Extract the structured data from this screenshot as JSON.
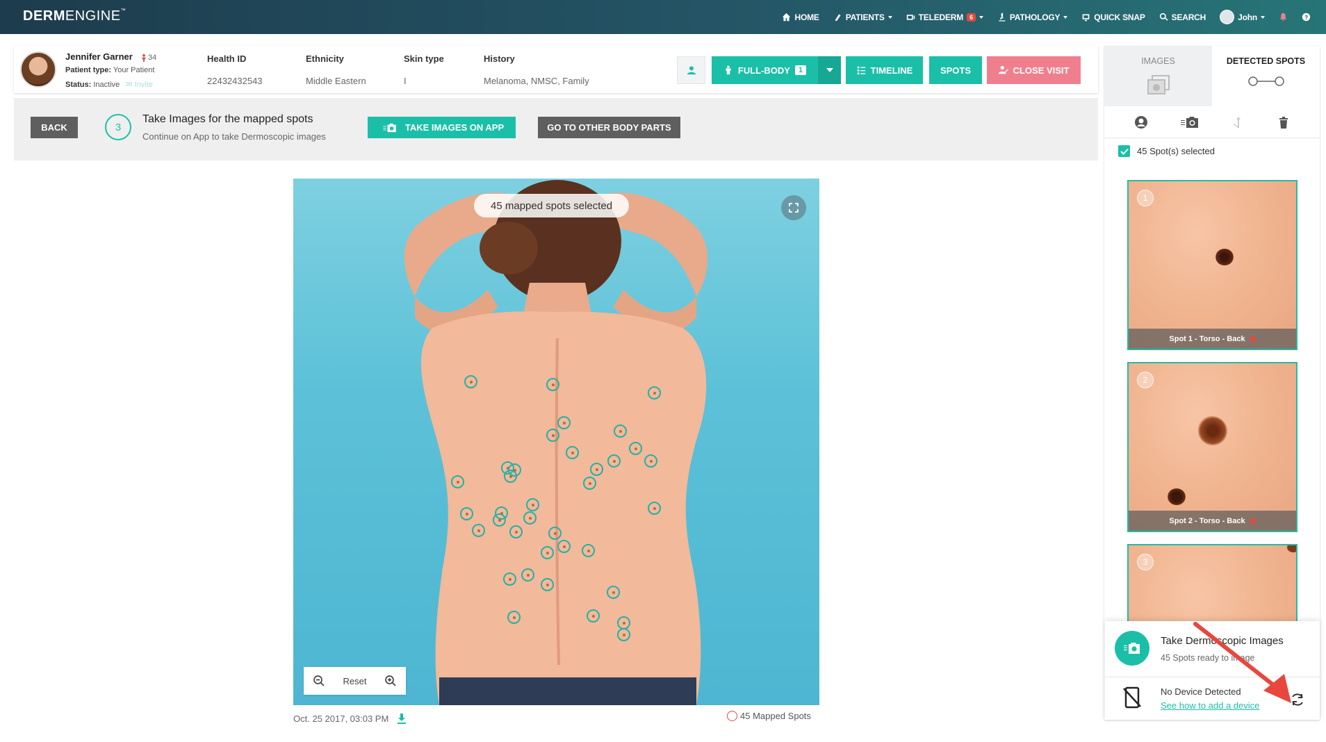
{
  "brand": {
    "bold": "DERM",
    "light": "ENGINE",
    "tm": "™"
  },
  "nav": {
    "items": [
      {
        "label": "HOME",
        "icon": "home-icon"
      },
      {
        "label": "PATIENTS",
        "icon": "user-icon",
        "caret": true
      },
      {
        "label": "TELEDERM",
        "icon": "telederm-icon",
        "badge": "6",
        "caret": true
      },
      {
        "label": "PATHOLOGY",
        "icon": "microscope-icon",
        "caret": true
      },
      {
        "label": "QUICK SNAP",
        "icon": "snap-icon"
      },
      {
        "label": "SEARCH",
        "icon": "search-icon"
      }
    ],
    "user": "John",
    "bell_icon": "bell-icon",
    "help_icon": "help-icon"
  },
  "patient": {
    "name": "Jennifer Garner",
    "age": "34",
    "type_label": "Patient type:",
    "type_value": "Your Patient",
    "status_label": "Status:",
    "status_value": "Inactive",
    "invite": "Invite",
    "fields": [
      {
        "label": "Health ID",
        "value": "22432432543"
      },
      {
        "label": "Ethnicity",
        "value": "Middle Eastern"
      },
      {
        "label": "Skin type",
        "value": "I"
      },
      {
        "label": "History",
        "value": "Melanoma, NMSC, Family"
      }
    ]
  },
  "header_buttons": {
    "full_body": "FULL-BODY",
    "full_body_count": "1",
    "timeline": "TIMELINE",
    "spots": "SPOTS",
    "close_visit": "CLOSE VISIT"
  },
  "action_strip": {
    "back": "BACK",
    "step_number": "3",
    "step_title": "Take Images for the mapped spots",
    "step_subtitle": "Continue on App to take Dermoscopic images",
    "take_images": "TAKE IMAGES ON APP",
    "other_parts": "GO TO OTHER BODY PARTS"
  },
  "viewer": {
    "pill": "45 mapped spots selected",
    "reset": "Reset",
    "date": "Oct. 25 2017, 03:03 PM",
    "mapped_count": "45 Mapped Spots",
    "spots": [
      [
        33.8,
        38.6
      ],
      [
        49.4,
        39.1
      ],
      [
        68.6,
        40.7
      ],
      [
        51.5,
        46.4
      ],
      [
        49.4,
        48.8
      ],
      [
        62.1,
        48.0
      ],
      [
        65.1,
        51.3
      ],
      [
        53.0,
        52.1
      ],
      [
        67.9,
        53.6
      ],
      [
        61.0,
        53.6
      ],
      [
        57.7,
        55.2
      ],
      [
        40.7,
        54.9
      ],
      [
        42.1,
        55.4
      ],
      [
        41.3,
        56.5
      ],
      [
        56.3,
        57.9
      ],
      [
        31.2,
        57.6
      ],
      [
        68.6,
        62.6
      ],
      [
        45.5,
        61.9
      ],
      [
        39.6,
        63.5
      ],
      [
        33.0,
        63.7
      ],
      [
        39.2,
        64.8
      ],
      [
        45.0,
        64.5
      ],
      [
        35.2,
        66.8
      ],
      [
        42.3,
        67.1
      ],
      [
        49.8,
        67.4
      ],
      [
        51.5,
        69.9
      ],
      [
        48.3,
        71.1
      ],
      [
        56.1,
        70.6
      ],
      [
        41.2,
        76.1
      ],
      [
        44.6,
        75.2
      ],
      [
        48.3,
        77.1
      ],
      [
        60.8,
        78.5
      ],
      [
        41.9,
        83.3
      ],
      [
        57.0,
        83.1
      ],
      [
        62.8,
        84.4
      ],
      [
        62.8,
        86.6
      ]
    ]
  },
  "right_panel": {
    "tab_images": "IMAGES",
    "tab_detected": "DETECTED SPOTS",
    "selected": "45 Spot(s) selected",
    "thumbs": [
      {
        "num": "1",
        "caption": "Spot 1 - Torso - Back"
      },
      {
        "num": "2",
        "caption": "Spot 2 - Torso - Back"
      },
      {
        "num": "3",
        "caption": ""
      }
    ]
  },
  "notice": {
    "title": "Take Dermoscopic Images",
    "subtitle": "45 Spots ready to image",
    "device_title": "No Device Detected",
    "device_link": "See how to add a device"
  },
  "colors": {
    "accent": "#1bbfa8",
    "danger": "#e8473e",
    "close_visit": "#f07f8e",
    "nav_start": "#1d3c4d",
    "nav_end": "#277577"
  }
}
